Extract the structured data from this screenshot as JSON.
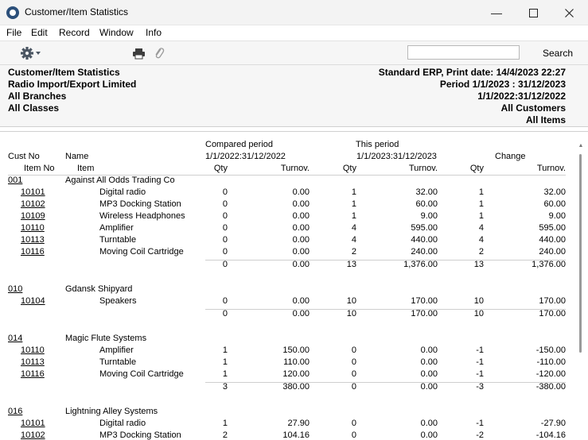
{
  "window": {
    "title": "Customer/Item Statistics",
    "minimize_glyph": "—",
    "maximize_glyph": "☐",
    "close_glyph": "✕"
  },
  "menu": [
    "File",
    "Edit",
    "Record",
    "Window",
    "Info"
  ],
  "toolbar": {
    "search_placeholder": "",
    "search_label": "Search"
  },
  "header": {
    "left": [
      "Customer/Item Statistics",
      "Radio Import/Export Limited",
      "All Branches",
      "All Classes"
    ],
    "right": [
      "Standard ERP, Print date:  14/4/2023 22:27",
      "Period   1/1/2023 : 31/12/2023",
      "1/1/2022:31/12/2022",
      "All Customers",
      "All Items"
    ]
  },
  "columns": {
    "compared_period": "Compared period",
    "compared_range": "1/1/2022:31/12/2022",
    "this_period": "This period",
    "this_range": "1/1/2023:31/12/2023",
    "change": "Change",
    "cust_no": "Cust No",
    "name": "Name",
    "item_no": "Item No",
    "item": "Item",
    "qty": "Qty",
    "turnover": "Turnov."
  },
  "customers": [
    {
      "no": "001",
      "name": "Against All Odds Trading Co",
      "items": [
        {
          "no": "10101",
          "name": "Digital radio",
          "cq": "0",
          "ct": "0.00",
          "tq": "1",
          "tt": "32.00",
          "dq": "1",
          "dt": "32.00"
        },
        {
          "no": "10102",
          "name": "MP3 Docking Station",
          "cq": "0",
          "ct": "0.00",
          "tq": "1",
          "tt": "60.00",
          "dq": "1",
          "dt": "60.00"
        },
        {
          "no": "10109",
          "name": "Wireless Headphones",
          "cq": "0",
          "ct": "0.00",
          "tq": "1",
          "tt": "9.00",
          "dq": "1",
          "dt": "9.00"
        },
        {
          "no": "10110",
          "name": "Amplifier",
          "cq": "0",
          "ct": "0.00",
          "tq": "4",
          "tt": "595.00",
          "dq": "4",
          "dt": "595.00"
        },
        {
          "no": "10113",
          "name": "Turntable",
          "cq": "0",
          "ct": "0.00",
          "tq": "4",
          "tt": "440.00",
          "dq": "4",
          "dt": "440.00"
        },
        {
          "no": "10116",
          "name": "Moving Coil Cartridge",
          "cq": "0",
          "ct": "0.00",
          "tq": "2",
          "tt": "240.00",
          "dq": "2",
          "dt": "240.00"
        }
      ],
      "total": {
        "cq": "0",
        "ct": "0.00",
        "tq": "13",
        "tt": "1,376.00",
        "dq": "13",
        "dt": "1,376.00"
      }
    },
    {
      "no": "010",
      "name": "Gdansk Shipyard",
      "items": [
        {
          "no": "10104",
          "name": "Speakers",
          "cq": "0",
          "ct": "0.00",
          "tq": "10",
          "tt": "170.00",
          "dq": "10",
          "dt": "170.00"
        }
      ],
      "total": {
        "cq": "0",
        "ct": "0.00",
        "tq": "10",
        "tt": "170.00",
        "dq": "10",
        "dt": "170.00"
      }
    },
    {
      "no": "014",
      "name": "Magic Flute Systems",
      "items": [
        {
          "no": "10110",
          "name": "Amplifier",
          "cq": "1",
          "ct": "150.00",
          "tq": "0",
          "tt": "0.00",
          "dq": "-1",
          "dt": "-150.00"
        },
        {
          "no": "10113",
          "name": "Turntable",
          "cq": "1",
          "ct": "110.00",
          "tq": "0",
          "tt": "0.00",
          "dq": "-1",
          "dt": "-110.00"
        },
        {
          "no": "10116",
          "name": "Moving Coil Cartridge",
          "cq": "1",
          "ct": "120.00",
          "tq": "0",
          "tt": "0.00",
          "dq": "-1",
          "dt": "-120.00"
        }
      ],
      "total": {
        "cq": "3",
        "ct": "380.00",
        "tq": "0",
        "tt": "0.00",
        "dq": "-3",
        "dt": "-380.00"
      }
    },
    {
      "no": "016",
      "name": "Lightning Alley Systems",
      "items": [
        {
          "no": "10101",
          "name": "Digital radio",
          "cq": "1",
          "ct": "27.90",
          "tq": "0",
          "tt": "0.00",
          "dq": "-1",
          "dt": "-27.90"
        },
        {
          "no": "10102",
          "name": "MP3 Docking Station",
          "cq": "2",
          "ct": "104.16",
          "tq": "0",
          "tt": "0.00",
          "dq": "-2",
          "dt": "-104.16"
        }
      ],
      "total": null
    }
  ],
  "icons": {
    "settings": "gear-icon",
    "print": "printer-icon",
    "attach": "paperclip-icon"
  }
}
